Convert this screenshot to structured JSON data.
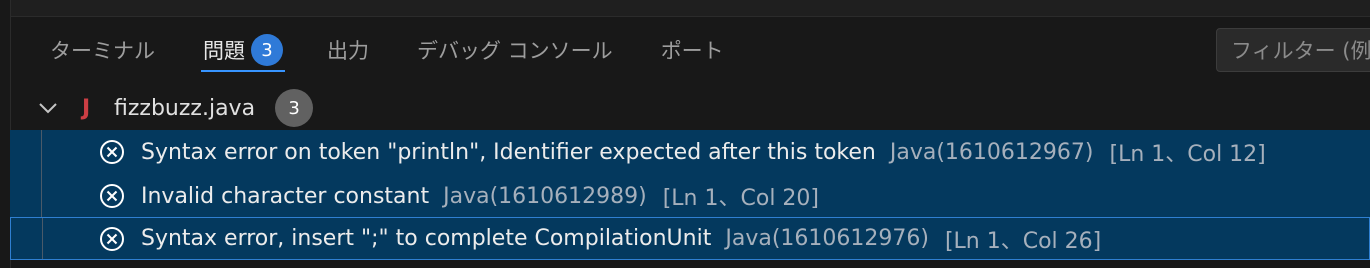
{
  "tabs": [
    {
      "label": "ターミナル"
    },
    {
      "label": "問題",
      "count": "3"
    },
    {
      "label": "出力"
    },
    {
      "label": "デバッグ コンソール"
    },
    {
      "label": "ポート"
    }
  ],
  "filter": {
    "placeholder": "フィルター (例"
  },
  "file": {
    "icon": "java-icon",
    "icon_glyph": "J",
    "name": "fizzbuzz.java",
    "count": "3"
  },
  "problems": [
    {
      "message": "Syntax error on token \"println\", Identifier expected after this token",
      "source": "Java(1610612967)",
      "location": "[Ln 1、Col 12]"
    },
    {
      "message": "Invalid character constant",
      "source": "Java(1610612989)",
      "location": "[Ln 1、Col 20]"
    },
    {
      "message": "Syntax error, insert \";\" to complete CompilationUnit",
      "source": "Java(1610612976)",
      "location": "[Ln 1、Col 26]"
    }
  ],
  "colors": {
    "accent": "#3794ff",
    "badge": "#2f7ad8",
    "selection": "#04395e",
    "java_icon": "#cc3e44"
  }
}
